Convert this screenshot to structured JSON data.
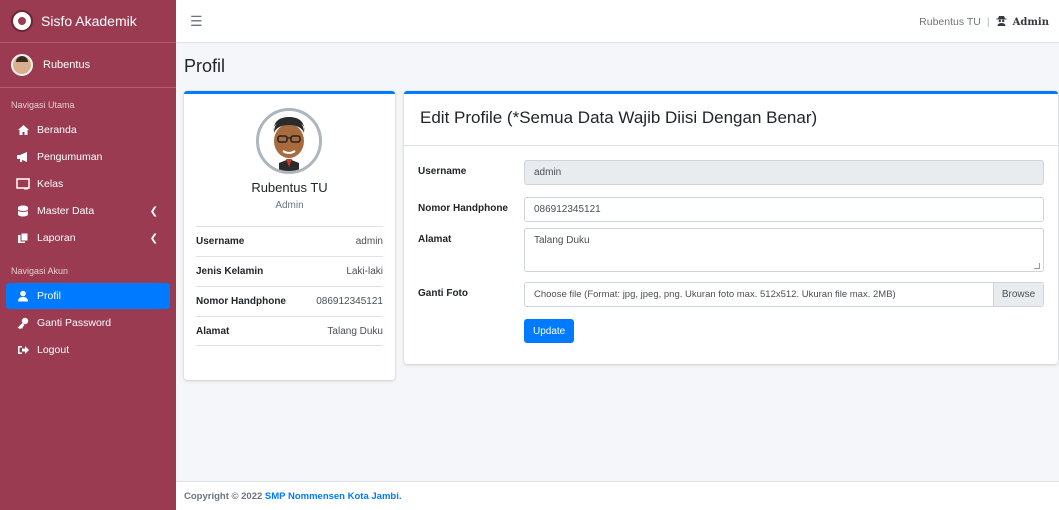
{
  "brand": {
    "title": "Sisfo Akademik"
  },
  "user": {
    "name": "Rubentus"
  },
  "sidebar": {
    "header_main": "Navigasi Utama",
    "items": [
      {
        "label": "Beranda",
        "icon": "home-icon"
      },
      {
        "label": "Pengumuman",
        "icon": "megaphone-icon"
      },
      {
        "label": "Kelas",
        "icon": "chalkboard-icon"
      },
      {
        "label": "Master Data",
        "icon": "database-icon"
      },
      {
        "label": "Laporan",
        "icon": "copy-icon"
      }
    ],
    "header_account": "Navigasi Akun",
    "account_items": [
      {
        "label": "Profil",
        "icon": "user-icon"
      },
      {
        "label": "Ganti Password",
        "icon": "key-icon"
      },
      {
        "label": "Logout",
        "icon": "sign-out-icon"
      }
    ]
  },
  "topbar": {
    "user_name": "Rubentus TU",
    "separator": "|",
    "role": "Admin"
  },
  "page": {
    "title": "Profil"
  },
  "profile_card": {
    "name": "Rubentus TU",
    "role": "Admin",
    "rows": [
      {
        "key": "Username",
        "value": "admin"
      },
      {
        "key": "Jenis Kelamin",
        "value": "Laki-laki"
      },
      {
        "key": "Nomor Handphone",
        "value": "086912345121"
      },
      {
        "key": "Alamat",
        "value": "Talang Duku"
      }
    ]
  },
  "edit_form": {
    "title": "Edit Profile (*Semua Data Wajib Diisi Dengan Benar)",
    "username_label": "Username",
    "username_value": "admin",
    "phone_label": "Nomor Handphone",
    "phone_value": "086912345121",
    "address_label": "Alamat",
    "address_value": "Talang Duku",
    "photo_label": "Ganti Foto",
    "photo_placeholder": "Choose file (Format: jpg, jpeg, png. Ukuran foto max. 512x512. Ukuran file max. 2MB)",
    "browse_label": "Browse",
    "update_label": "Update"
  },
  "footer": {
    "copyright": "Copyright © 2022 ",
    "link_text": "SMP Nommensen Kota Jambi."
  },
  "colors": {
    "sidebar": "#9a3b52",
    "accent": "#007bff"
  }
}
